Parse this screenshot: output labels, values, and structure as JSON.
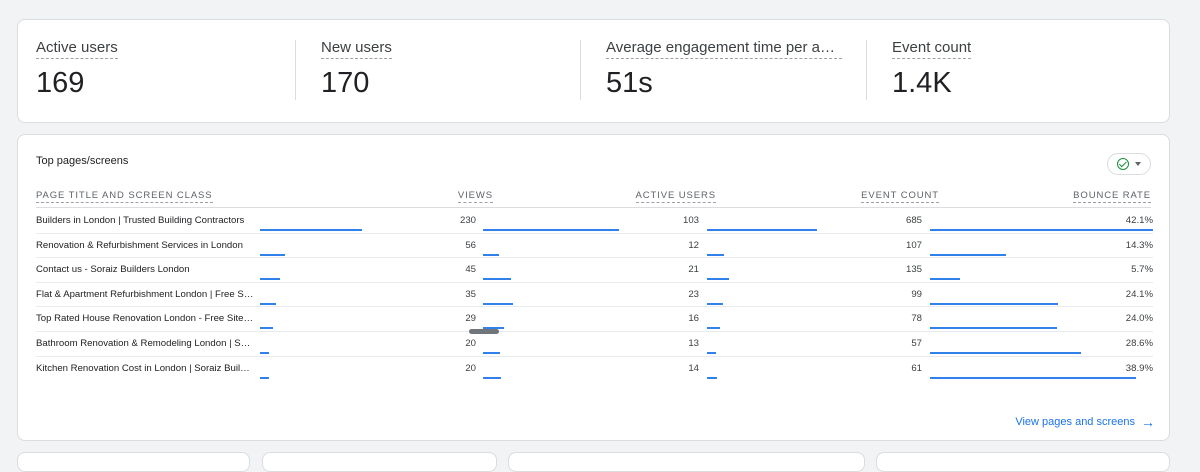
{
  "metrics": [
    {
      "label": "Active users",
      "value": "169"
    },
    {
      "label": "New users",
      "value": "170"
    },
    {
      "label": "Average engagement time per active user",
      "value": "51s"
    },
    {
      "label": "Event count",
      "value": "1.4K"
    }
  ],
  "top_pages": {
    "title": "Top pages/screens",
    "columns": [
      "PAGE TITLE AND SCREEN CLASS",
      "VIEWS",
      "ACTIVE USERS",
      "EVENT COUNT",
      "BOUNCE RATE"
    ],
    "rows": [
      {
        "page": "Builders in London | Trusted Building Contractors",
        "views": "230",
        "active_users": "103",
        "event_count": "685",
        "bounce_rate": "42.1%",
        "views_n": 230,
        "users_n": 103,
        "events_n": 685,
        "bounce_n": 42.1
      },
      {
        "page": "Renovation & Refurbishment Services in London",
        "views": "56",
        "active_users": "12",
        "event_count": "107",
        "bounce_rate": "14.3%",
        "views_n": 56,
        "users_n": 12,
        "events_n": 107,
        "bounce_n": 14.3
      },
      {
        "page": "Contact us - Soraiz Builders London",
        "views": "45",
        "active_users": "21",
        "event_count": "135",
        "bounce_rate": "5.7%",
        "views_n": 45,
        "users_n": 21,
        "events_n": 135,
        "bounce_n": 5.7
      },
      {
        "page": "Flat & Apartment Refurbishment London | Free Site Visit",
        "views": "35",
        "active_users": "23",
        "event_count": "99",
        "bounce_rate": "24.1%",
        "views_n": 35,
        "users_n": 23,
        "events_n": 99,
        "bounce_n": 24.1
      },
      {
        "page": "Top Rated House Renovation London - Free Site Visit",
        "views": "29",
        "active_users": "16",
        "event_count": "78",
        "bounce_rate": "24.0%",
        "views_n": 29,
        "users_n": 16,
        "events_n": 78,
        "bounce_n": 24.0
      },
      {
        "page": "Bathroom Renovation & Remodeling London | Soraiz",
        "views": "20",
        "active_users": "13",
        "event_count": "57",
        "bounce_rate": "28.6%",
        "views_n": 20,
        "users_n": 13,
        "events_n": 57,
        "bounce_n": 28.6
      },
      {
        "page": "Kitchen Renovation Cost in London | Soraiz Builders",
        "views": "20",
        "active_users": "14",
        "event_count": "61",
        "bounce_rate": "38.9%",
        "views_n": 20,
        "users_n": 14,
        "events_n": 61,
        "bounce_n": 38.9
      }
    ],
    "view_link": "View pages and screens"
  },
  "colors": {
    "accent": "#1a73e8",
    "check": "#1e8e3e"
  },
  "icons": {
    "filter": "check-circle-icon",
    "dropdown": "caret-down-icon",
    "link": "arrow-right-icon"
  }
}
